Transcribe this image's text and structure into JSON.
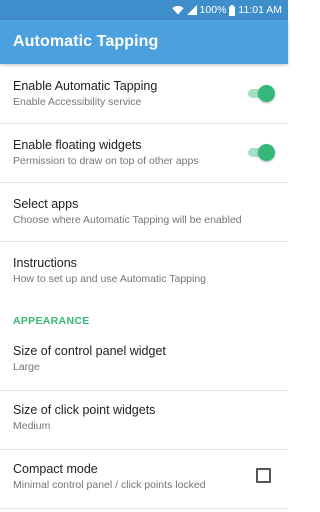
{
  "status_bar": {
    "battery": "100%",
    "time": "11:01 AM",
    "icons": [
      "wifi-icon",
      "signal-icon",
      "battery-icon"
    ]
  },
  "toolbar": {
    "title": "Automatic Tapping"
  },
  "colors": {
    "status_bar": "#3f8ecc",
    "toolbar": "#4ba1e0",
    "accent": "#34b779"
  },
  "settings": [
    {
      "title": "Enable Automatic Tapping",
      "subtitle": "Enable Accessibility service",
      "control": "toggle",
      "checked": true
    },
    {
      "title": "Enable floating widgets",
      "subtitle": "Permission to draw on top of other apps",
      "control": "toggle",
      "checked": true
    },
    {
      "title": "Select apps",
      "subtitle": "Choose where Automatic Tapping will be enabled",
      "control": "none"
    },
    {
      "title": "Instructions",
      "subtitle": "How to set up and use Automatic Tapping",
      "control": "none"
    }
  ],
  "appearance": {
    "header": "APPEARANCE",
    "items": [
      {
        "title": "Size of control panel widget",
        "subtitle": "Large",
        "control": "none"
      },
      {
        "title": "Size of click point widgets",
        "subtitle": "Medium",
        "control": "none"
      },
      {
        "title": "Compact mode",
        "subtitle": "Minimal control panel / click points locked",
        "control": "checkbox",
        "checked": false
      }
    ]
  }
}
